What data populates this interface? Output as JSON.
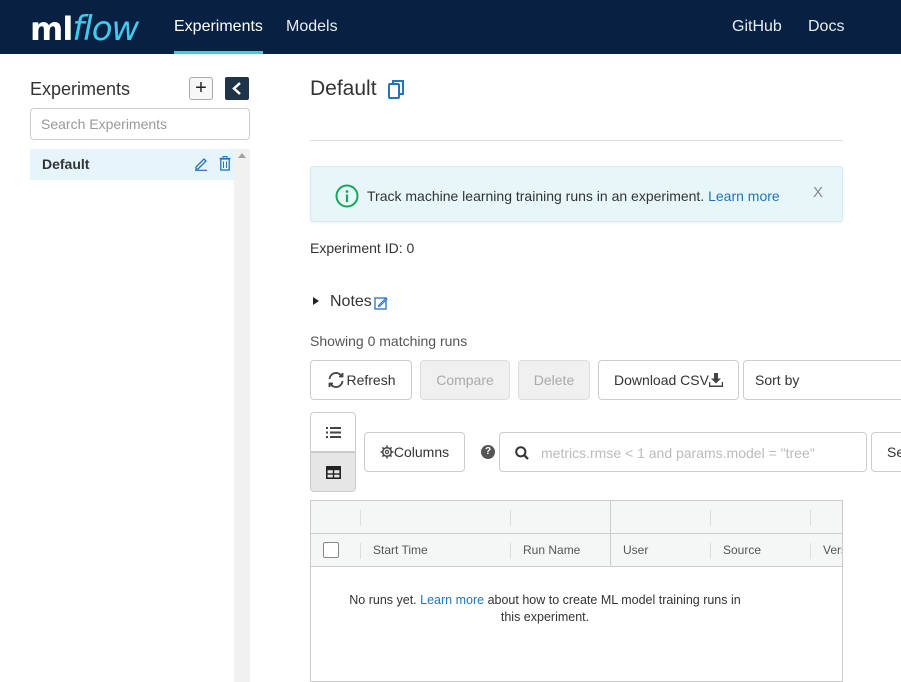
{
  "header": {
    "logo_ml": "ml",
    "logo_flow": "flow",
    "nav": [
      {
        "label": "Experiments",
        "active": true
      },
      {
        "label": "Models",
        "active": false
      }
    ],
    "right_nav": [
      {
        "label": "GitHub"
      },
      {
        "label": "Docs"
      }
    ]
  },
  "sidebar": {
    "title": "Experiments",
    "add_label": "+",
    "search_placeholder": "Search Experiments",
    "experiments": [
      {
        "name": "Default",
        "selected": true
      }
    ]
  },
  "main": {
    "title": "Default",
    "alert": {
      "text": "Track machine learning training runs in an experiment.",
      "link": "Learn more",
      "close": "X"
    },
    "experiment_id_label": "Experiment ID:",
    "experiment_id": "0",
    "notes_label": "Notes",
    "showing_text": "Showing 0 matching runs",
    "buttons": {
      "refresh": "Refresh",
      "compare": "Compare",
      "delete": "Delete",
      "download_csv": "Download CSV",
      "sort_by": "Sort by",
      "columns": "Columns",
      "search": "Se"
    },
    "help": "?",
    "search_placeholder": "metrics.rmse < 1 and params.model = \"tree\"",
    "table": {
      "columns": [
        "Start Time",
        "Run Name",
        "User",
        "Source",
        "Vers"
      ],
      "empty_prefix": "No runs yet.",
      "empty_link": "Learn more",
      "empty_suffix": "about how to create ML model training runs in this experiment."
    }
  },
  "colors": {
    "header_bg": "#082142",
    "accent": "#43c9ed",
    "link": "#2374bb",
    "alert_bg": "#e6f6f9",
    "selected_bg": "#e6f4fb"
  }
}
